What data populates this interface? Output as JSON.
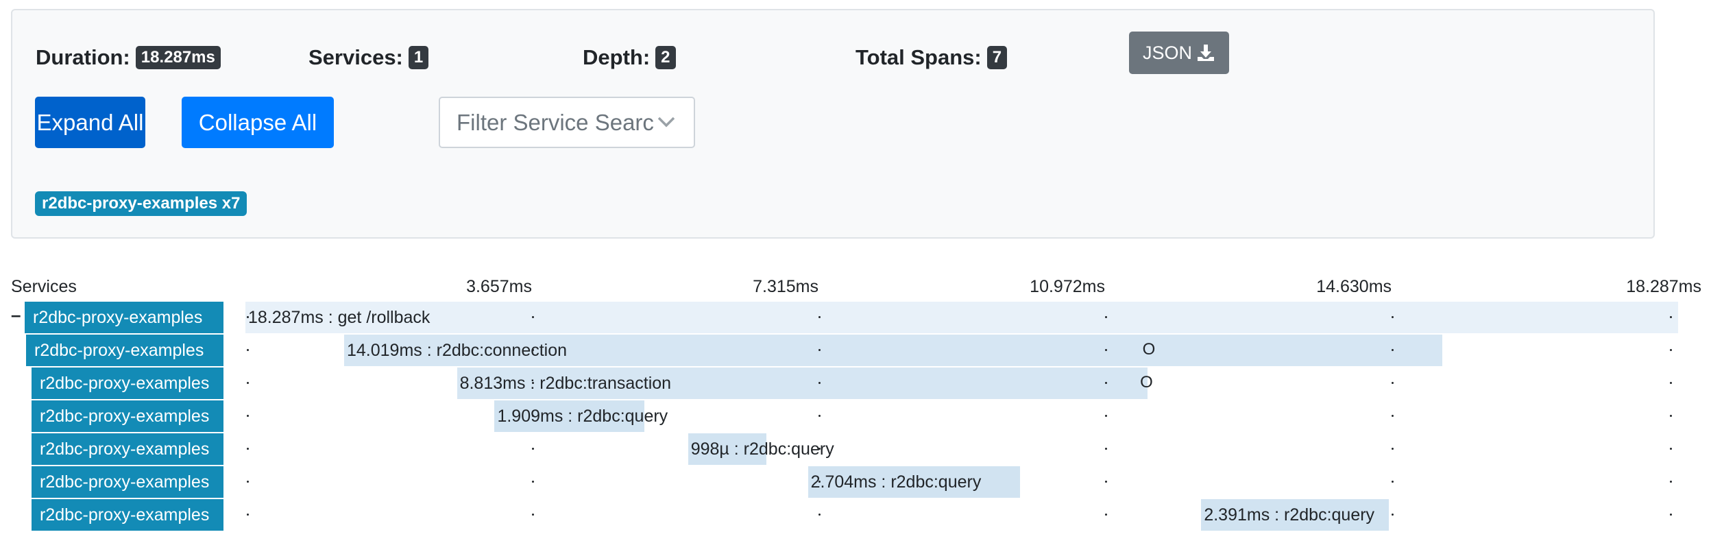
{
  "summary": {
    "duration_label": "Duration:",
    "duration_value": "18.287ms",
    "services_label": "Services:",
    "services_value": "1",
    "depth_label": "Depth:",
    "depth_value": "2",
    "total_spans_label": "Total Spans:",
    "total_spans_value": "7",
    "json_button": "JSON",
    "json_icon": "download-icon"
  },
  "controls": {
    "expand_all": "Expand All",
    "collapse_all": "Collapse All",
    "filter_placeholder": "Filter Service Searc"
  },
  "service_tag": "r2dbc-proxy-examples x7",
  "timeline": {
    "services_header": "Services",
    "total_ms": 18.287,
    "ticks": [
      "3.657ms",
      "7.315ms",
      "10.972ms",
      "14.630ms",
      "18.287ms"
    ],
    "tick_values": [
      0,
      3.657,
      7.315,
      10.972,
      14.63,
      18.287
    ],
    "spans": [
      {
        "service": "r2dbc-proxy-examples",
        "label": "18.287ms : get /rollback",
        "start_ms": 0,
        "duration_ms": 18.287,
        "depth": 0,
        "collapsible": true,
        "toggle": "–",
        "color": "#e8f1f9"
      },
      {
        "service": "r2dbc-proxy-examples",
        "label": "14.019ms : r2dbc:connection",
        "start_ms": 1.26,
        "duration_ms": 14.019,
        "depth": 1,
        "color": "#d6e6f3",
        "markers": [
          {
            "ms": 11.45,
            "text": "O"
          }
        ]
      },
      {
        "service": "r2dbc-proxy-examples",
        "label": "8.813ms : r2dbc:transaction",
        "start_ms": 2.7,
        "duration_ms": 8.813,
        "depth": 2,
        "color": "#d6e6f3",
        "markers": [
          {
            "ms": 11.42,
            "text": "O"
          }
        ]
      },
      {
        "service": "r2dbc-proxy-examples",
        "label": "1.909ms : r2dbc:query",
        "start_ms": 3.18,
        "duration_ms": 1.909,
        "depth": 2,
        "color": "#d1e3f1"
      },
      {
        "service": "r2dbc-proxy-examples",
        "label": "998µ : r2dbc:query",
        "start_ms": 5.65,
        "duration_ms": 0.998,
        "depth": 2,
        "color": "#d1e3f1"
      },
      {
        "service": "r2dbc-proxy-examples",
        "label": "2.704ms : r2dbc:query",
        "start_ms": 7.18,
        "duration_ms": 2.704,
        "depth": 2,
        "color": "#d1e3f1"
      },
      {
        "service": "r2dbc-proxy-examples",
        "label": "2.391ms : r2dbc:query",
        "start_ms": 12.2,
        "duration_ms": 2.391,
        "depth": 2,
        "color": "#d1e3f1"
      }
    ]
  }
}
